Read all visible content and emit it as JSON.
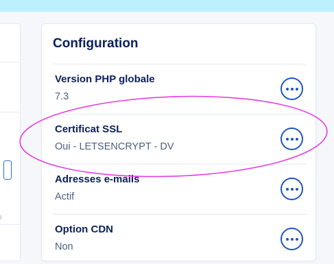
{
  "config": {
    "title": "Configuration",
    "rows": [
      {
        "label": "Version PHP globale",
        "value": "7.3",
        "action_icon": "more-horizontal-icon"
      },
      {
        "label": "Certificat SSL",
        "value": "Oui - LETSENCRYPT - DV",
        "action_icon": "more-horizontal-icon"
      },
      {
        "label": "Adresses e-mails",
        "value": "Actif",
        "action_icon": "more-horizontal-icon"
      },
      {
        "label": "Option CDN",
        "value": "Non",
        "action_icon": "more-horizontal-icon"
      }
    ]
  },
  "colors": {
    "top_band": "#bdf0fd",
    "title": "#0a1f5c",
    "value_text": "#4d5f7f",
    "accent": "#1c55c2",
    "highlight": "#e63ce0"
  }
}
